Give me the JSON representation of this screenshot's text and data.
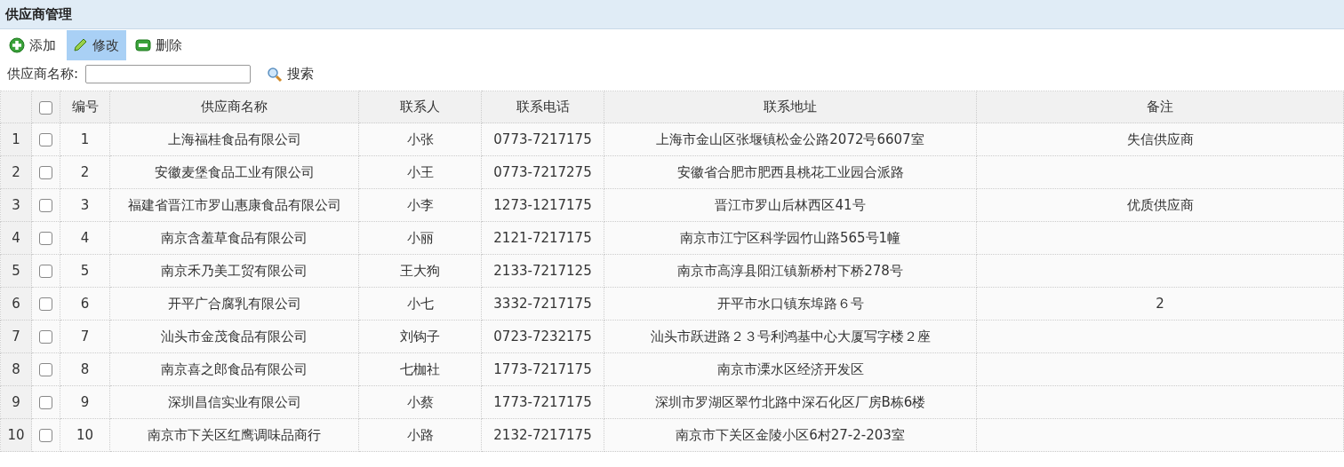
{
  "panel": {
    "title": "供应商管理"
  },
  "toolbar": [
    {
      "kind": "add",
      "label": "添加",
      "selected": false
    },
    {
      "kind": "edit",
      "label": "修改",
      "selected": true
    },
    {
      "kind": "delete",
      "label": "删除",
      "selected": false
    }
  ],
  "search": {
    "label": "供应商名称:",
    "button": "搜索"
  },
  "table": {
    "header_checked": false,
    "columns": [
      "编号",
      "供应商名称",
      "联系人",
      "联系电话",
      "联系地址",
      "备注"
    ],
    "rows": [
      {
        "row_number": "1",
        "checked": false,
        "cells": [
          "1",
          "上海福桂食品有限公司",
          "小张",
          "0773-7217175",
          "上海市金山区张堰镇松金公路2072号6607室",
          "失信供应商"
        ]
      },
      {
        "row_number": "2",
        "checked": false,
        "cells": [
          "2",
          "安徽麦堡食品工业有限公司",
          "小王",
          "0773-7217275",
          "安徽省合肥市肥西县桃花工业园合派路",
          null
        ]
      },
      {
        "row_number": "3",
        "checked": false,
        "cells": [
          "3",
          "福建省晋江市罗山惠康食品有限公司",
          "小李",
          "1273-1217175",
          "晋江市罗山后林西区41号",
          "优质供应商"
        ]
      },
      {
        "row_number": "4",
        "checked": false,
        "cells": [
          "4",
          "南京含羞草食品有限公司",
          "小丽",
          "2121-7217175",
          "南京市江宁区科学园竹山路565号1幢",
          null
        ]
      },
      {
        "row_number": "5",
        "checked": false,
        "cells": [
          "5",
          "南京禾乃美工贸有限公司",
          "王大狗",
          "2133-7217125",
          "南京市高淳县阳江镇新桥村下桥278号",
          null
        ]
      },
      {
        "row_number": "6",
        "checked": false,
        "cells": [
          "6",
          "开平广合腐乳有限公司",
          "小七",
          "3332-7217175",
          "开平市水口镇东埠路６号",
          "2"
        ]
      },
      {
        "row_number": "7",
        "checked": false,
        "cells": [
          "7",
          "汕头市金茂食品有限公司",
          "刘钩子",
          "0723-7232175",
          "汕头市跃进路２３号利鸿基中心大厦写字楼２座",
          null
        ]
      },
      {
        "row_number": "8",
        "checked": false,
        "cells": [
          "8",
          "南京喜之郎食品有限公司",
          "七枷社",
          "1773-7217175",
          "南京市溧水区经济开发区",
          null
        ]
      },
      {
        "row_number": "9",
        "checked": false,
        "cells": [
          "9",
          "深圳昌信实业有限公司",
          "小蔡",
          "1773-7217175",
          "深圳市罗湖区翠竹北路中深石化区厂房B栋6楼",
          null
        ]
      },
      {
        "row_number": "10",
        "checked": false,
        "cells": [
          "10",
          "南京市下关区红鹰调味品商行",
          "小路",
          "2132-7217175",
          "南京市下关区金陵小区6村27-2-203室",
          null
        ]
      }
    ]
  }
}
